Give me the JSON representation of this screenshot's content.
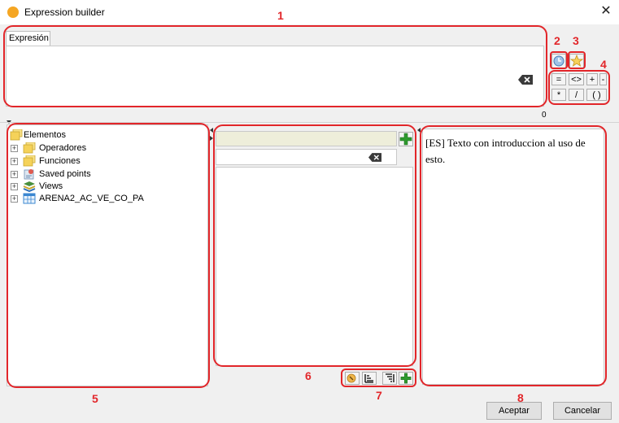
{
  "window": {
    "title": "Expression builder",
    "close_label": "✕"
  },
  "expression": {
    "tab_label": "Expresión",
    "value": "",
    "char_count": "0"
  },
  "operators": [
    "=",
    "<>",
    "+",
    "-",
    "*",
    "/",
    "( )"
  ],
  "tree": {
    "root": "Elementos",
    "items": [
      {
        "label": "Operadores",
        "icon": "folder-icon"
      },
      {
        "label": "Funciones",
        "icon": "folder-icon"
      },
      {
        "label": "Saved points",
        "icon": "saved-points-icon"
      },
      {
        "label": "Views",
        "icon": "views-layers-icon"
      },
      {
        "label": "ARENA2_AC_VE_CO_PA",
        "icon": "table-icon"
      }
    ]
  },
  "values_panel": {
    "search_value": ""
  },
  "help_text": "[ES] Texto con introduccion al uso de esto.",
  "buttons": {
    "accept": "Aceptar",
    "cancel": "Cancelar"
  },
  "annotations": [
    "1",
    "2",
    "3",
    "4",
    "5",
    "6",
    "7",
    "8"
  ],
  "colors": {
    "annotation_red": "#e2262a",
    "green_plus": "#2e9a2e"
  }
}
